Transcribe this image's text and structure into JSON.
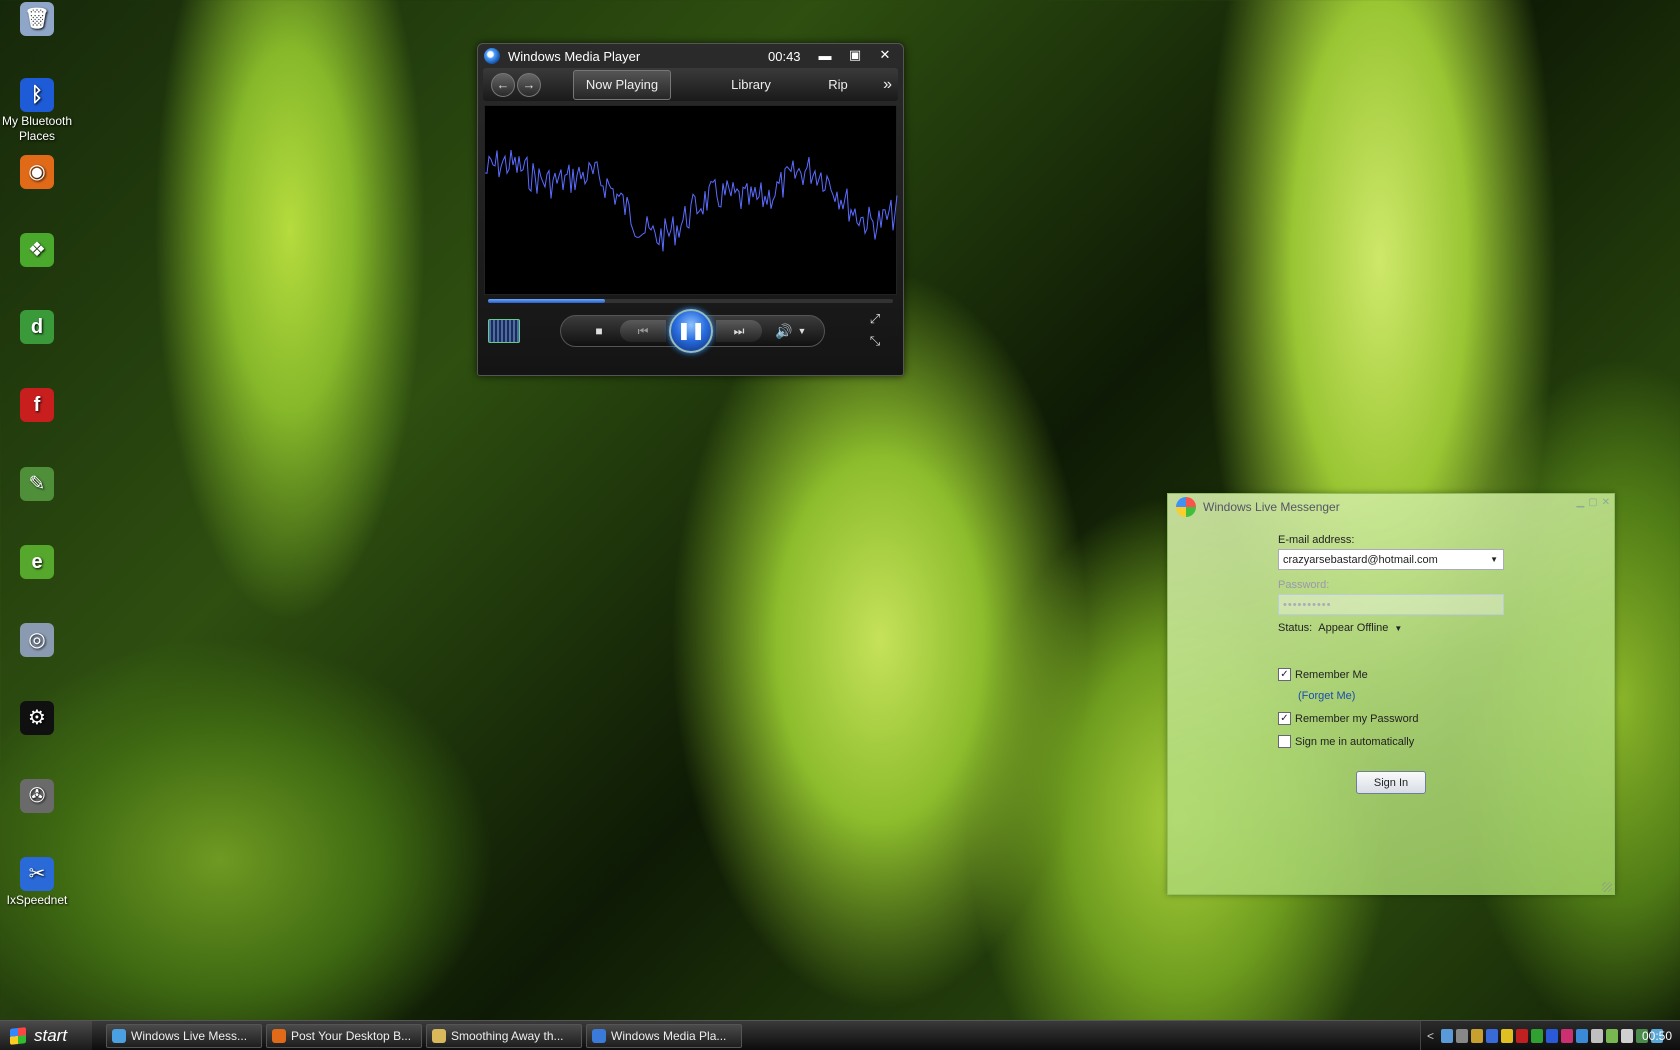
{
  "desktop": {
    "icons": [
      {
        "label": "",
        "icon": "recycle-bin-icon",
        "color": "#8fa6c8"
      },
      {
        "label": "My Bluetooth Places",
        "icon": "bluetooth-icon",
        "color": "#1e5bd6"
      },
      {
        "label": "",
        "icon": "firefox-icon",
        "color": "#e06a18"
      },
      {
        "label": "",
        "icon": "green-app-icon",
        "color": "#4aa82c"
      },
      {
        "label": "",
        "icon": "dreamweaver-icon",
        "color": "#3a9a3a"
      },
      {
        "label": "",
        "icon": "flash-icon",
        "color": "#c81e1e"
      },
      {
        "label": "",
        "icon": "paint-icon",
        "color": "#4f8f3a"
      },
      {
        "label": "",
        "icon": "ie-icon",
        "color": "#56a82c"
      },
      {
        "label": "",
        "icon": "cd-burner-icon",
        "color": "#8a9ab0"
      },
      {
        "label": "",
        "icon": "steam-icon",
        "color": "#101010"
      },
      {
        "label": "",
        "icon": "tools-icon",
        "color": "#6a6a6a"
      },
      {
        "label": "IxSpeednet",
        "icon": "ixspeednet-icon",
        "color": "#2a6ad8"
      }
    ]
  },
  "wmp": {
    "title": "Windows Media Player",
    "time": "00:43",
    "tabs": {
      "now_playing": "Now Playing",
      "library": "Library",
      "rip": "Rip",
      "more": "»"
    },
    "seek_progress": 0.29,
    "wave_color": "#5b6cff",
    "icons": {
      "back": "←",
      "forward": "→",
      "minimize": "▬",
      "maximize": "▣",
      "close": "✕",
      "stop": "■",
      "prev": "⏮",
      "pause": "❚❚",
      "next": "⏭",
      "volume": "🔊",
      "volume_drop": "▼",
      "fullscreen": "⤢",
      "mini": "⤡"
    }
  },
  "messenger": {
    "title": "Windows Live Messenger",
    "email_label": "E-mail address:",
    "email_value": "crazyarsebastard@hotmail.com",
    "password_label": "Password:",
    "password_value": "••••••••••",
    "status_label": "Status:",
    "status_value": "Appear Offline",
    "remember_me": "Remember Me",
    "forget_me": "(Forget Me)",
    "remember_password": "Remember my Password",
    "sign_in_auto": "Sign me in automatically",
    "sign_in_button": "Sign In",
    "checks": {
      "remember_me": true,
      "remember_password": true,
      "sign_in_auto": false
    }
  },
  "taskbar": {
    "start_label": "start",
    "tasks": [
      {
        "label": "Windows Live Mess...",
        "color": "#4aa0e0"
      },
      {
        "label": "Post Your Desktop B...",
        "color": "#e06a18"
      },
      {
        "label": "Smoothing Away th...",
        "color": "#d8b85a"
      },
      {
        "label": "Windows Media Pla...",
        "color": "#3a7ad8"
      }
    ],
    "tray_expand": "<",
    "clock": "00:50"
  }
}
